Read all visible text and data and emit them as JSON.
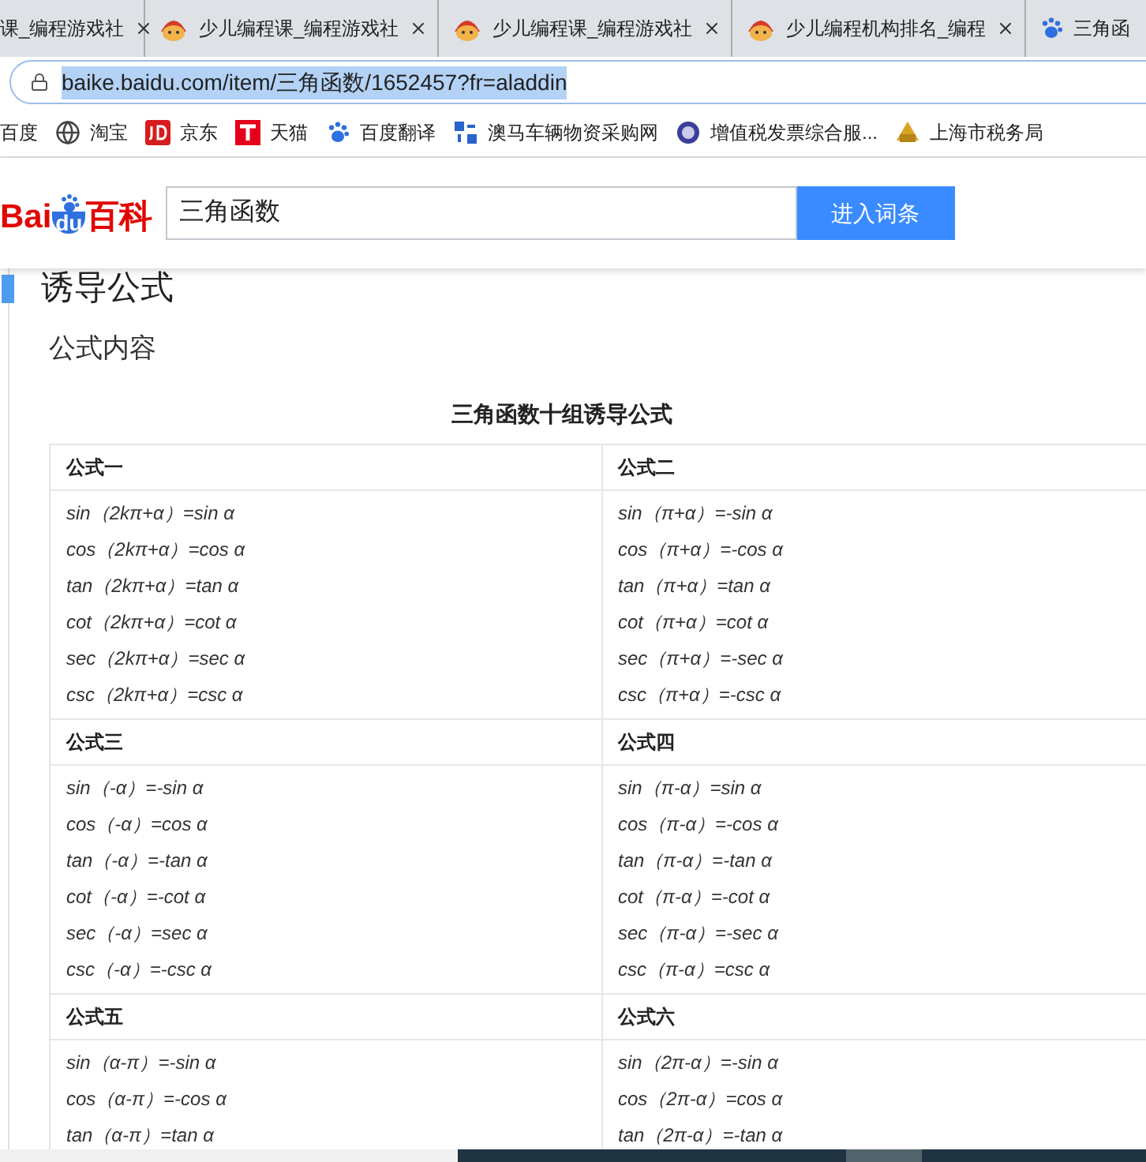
{
  "tabs": [
    {
      "title": "课_编程游戏社",
      "kind": "plain"
    },
    {
      "title": "少儿编程课_编程游戏社",
      "kind": "mascot"
    },
    {
      "title": "少儿编程课_编程游戏社",
      "kind": "mascot"
    },
    {
      "title": "少儿编程机构排名_编程",
      "kind": "mascot"
    },
    {
      "title": "三角函",
      "kind": "paw"
    }
  ],
  "address_bar": {
    "url": "baike.baidu.com/item/三角函数/1652457?fr=aladdin"
  },
  "bookmarks": [
    {
      "label": "百度",
      "kind": "plain"
    },
    {
      "label": "淘宝",
      "kind": "globe"
    },
    {
      "label": "京东",
      "kind": "jd"
    },
    {
      "label": "天猫",
      "kind": "tmall"
    },
    {
      "label": "百度翻译",
      "kind": "paw"
    },
    {
      "label": "澳马车辆物资采购网",
      "kind": "ap"
    },
    {
      "label": "增值税发票综合服...",
      "kind": "disc"
    },
    {
      "label": "上海市税务局",
      "kind": "badge"
    }
  ],
  "header": {
    "logo_left": "Bai",
    "logo_mid": "du",
    "logo_right": "百科",
    "search_value": "三角函数",
    "search_button": "进入词条"
  },
  "section_title": "诱导公式",
  "subtitle": "公式内容",
  "table_title": "三角函数十组诱导公式",
  "table_rows": [
    {
      "cells": [
        {
          "heading": "公式一",
          "formulas": [
            "sin（2kπ+α）=sin α",
            "cos（2kπ+α）=cos α",
            "tan（2kπ+α）=tan α",
            "cot（2kπ+α）=cot α",
            "sec（2kπ+α）=sec α",
            "csc（2kπ+α）=csc α"
          ]
        },
        {
          "heading": "公式二",
          "formulas": [
            "sin（π+α）=-sin α",
            "cos（π+α）=-cos α",
            "tan（π+α）=tan α",
            "cot（π+α）=cot α",
            "sec（π+α）=-sec α",
            "csc（π+α）=-csc α"
          ]
        }
      ]
    },
    {
      "cells": [
        {
          "heading": "公式三",
          "formulas": [
            "sin（-α）=-sin α",
            "cos（-α）=cos α",
            "tan（-α）=-tan α",
            "cot（-α）=-cot α",
            "sec（-α）=sec α",
            "csc（-α）=-csc α"
          ]
        },
        {
          "heading": "公式四",
          "formulas": [
            "sin（π-α）=sin α",
            "cos（π-α）=-cos α",
            "tan（π-α）=-tan α",
            "cot（π-α）=-cot α",
            "sec（π-α）=-sec α",
            "csc（π-α）=csc α"
          ]
        }
      ]
    },
    {
      "cells": [
        {
          "heading": "公式五",
          "formulas": [
            "sin（α-π）=-sin α",
            "cos（α-π）=-cos α",
            "tan（α-π）=tan α"
          ]
        },
        {
          "heading": "公式六",
          "formulas": [
            "sin（2π-α）=-sin α",
            "cos（2π-α）=cos α",
            "tan（2π-α）=-tan α"
          ]
        }
      ]
    }
  ]
}
